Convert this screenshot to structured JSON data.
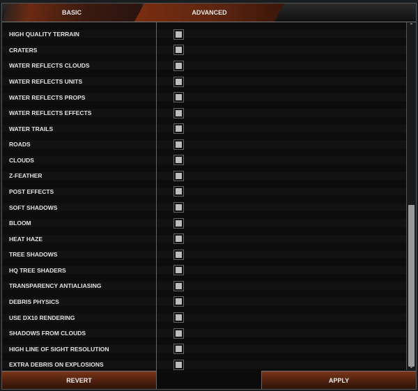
{
  "tabs": [
    {
      "label": "BASIC",
      "active": false
    },
    {
      "label": "ADVANCED",
      "active": true
    }
  ],
  "settings": [
    {
      "label": "HIGH QUALITY TERRAIN",
      "checked": false
    },
    {
      "label": "CRATERS",
      "checked": false
    },
    {
      "label": "WATER REFLECTS CLOUDS",
      "checked": false
    },
    {
      "label": "WATER REFLECTS UNITS",
      "checked": false
    },
    {
      "label": "WATER REFLECTS PROPS",
      "checked": false
    },
    {
      "label": "WATER REFLECTS EFFECTS",
      "checked": false
    },
    {
      "label": "WATER TRAILS",
      "checked": false
    },
    {
      "label": "ROADS",
      "checked": false
    },
    {
      "label": "CLOUDS",
      "checked": false
    },
    {
      "label": "Z-FEATHER",
      "checked": false
    },
    {
      "label": "POST EFFECTS",
      "checked": false
    },
    {
      "label": "SOFT SHADOWS",
      "checked": false
    },
    {
      "label": "BLOOM",
      "checked": false
    },
    {
      "label": "HEAT HAZE",
      "checked": false
    },
    {
      "label": "TREE SHADOWS",
      "checked": false
    },
    {
      "label": "HQ TREE SHADERS",
      "checked": false
    },
    {
      "label": "TRANSPARENCY ANTIALIASING",
      "checked": false
    },
    {
      "label": "DEBRIS PHYSICS",
      "checked": false
    },
    {
      "label": "USE DX10 RENDERING",
      "checked": false
    },
    {
      "label": "SHADOWS FROM CLOUDS",
      "checked": false
    },
    {
      "label": "HIGH LINE OF SIGHT RESOLUTION",
      "checked": false
    },
    {
      "label": "EXTRA DEBRIS ON EXPLOSIONS",
      "checked": false
    }
  ],
  "scrollbar": {
    "position": "bottom",
    "visible_fraction": 0.47
  },
  "buttons": {
    "revert": "REVERT",
    "apply": "APPLY"
  },
  "colors": {
    "accent": "#6b2a12",
    "checkbox": "#bdbdbd"
  }
}
